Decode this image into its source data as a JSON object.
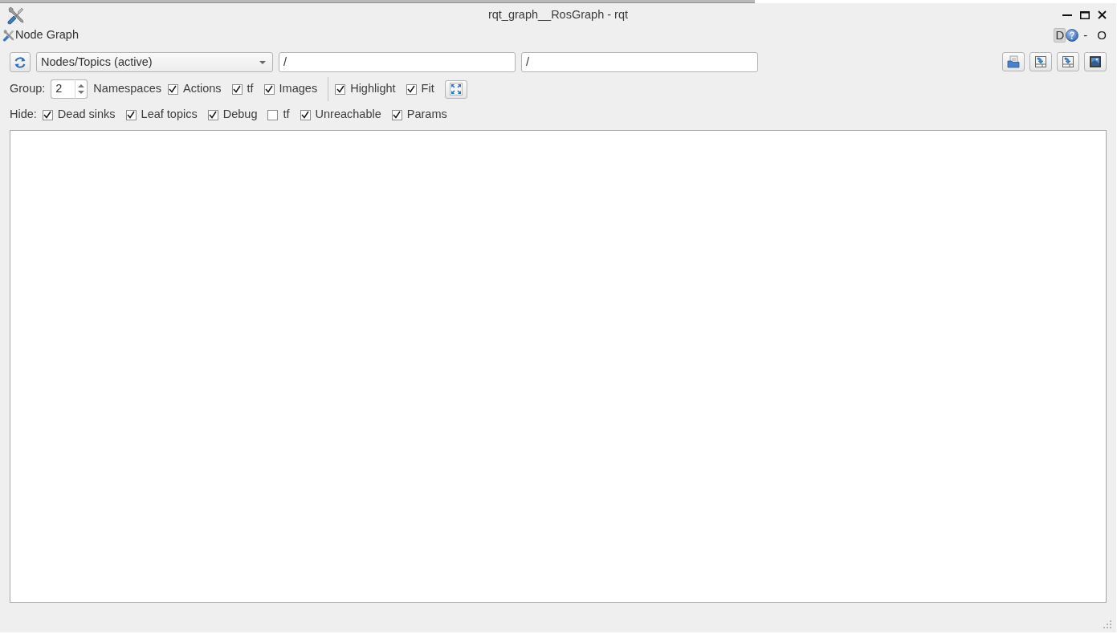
{
  "window": {
    "title": "rqt_graph__RosGraph - rqt"
  },
  "dock": {
    "title": "Node Graph",
    "controls": [
      {
        "kind": "button",
        "label": "D"
      },
      {
        "kind": "help"
      },
      {
        "kind": "text",
        "label": "-"
      },
      {
        "kind": "text",
        "label": "O"
      }
    ]
  },
  "toolbar": {
    "graph_type": "Nodes/Topics (active)",
    "filters": [
      {
        "value": "/"
      },
      {
        "value": "/"
      }
    ]
  },
  "options": {
    "group_label": "Group:",
    "group_value": "2",
    "items": [
      {
        "kind": "label",
        "label": "Namespaces"
      },
      {
        "kind": "checkbox",
        "label": "Actions",
        "checked": true
      },
      {
        "kind": "checkbox",
        "label": "tf",
        "checked": true
      },
      {
        "kind": "checkbox",
        "label": "Images",
        "checked": true
      },
      {
        "kind": "separator"
      },
      {
        "kind": "checkbox",
        "label": "Highlight",
        "checked": true
      },
      {
        "kind": "checkbox",
        "label": "Fit",
        "checked": true
      },
      {
        "kind": "fit_button"
      }
    ]
  },
  "hide": {
    "label": "Hide:",
    "items": [
      {
        "label": "Dead sinks",
        "checked": true
      },
      {
        "label": "Leaf topics",
        "checked": true
      },
      {
        "label": "Debug",
        "checked": true
      },
      {
        "label": "tf",
        "checked": false
      },
      {
        "label": "Unreachable",
        "checked": true
      },
      {
        "label": "Params",
        "checked": true
      }
    ]
  }
}
